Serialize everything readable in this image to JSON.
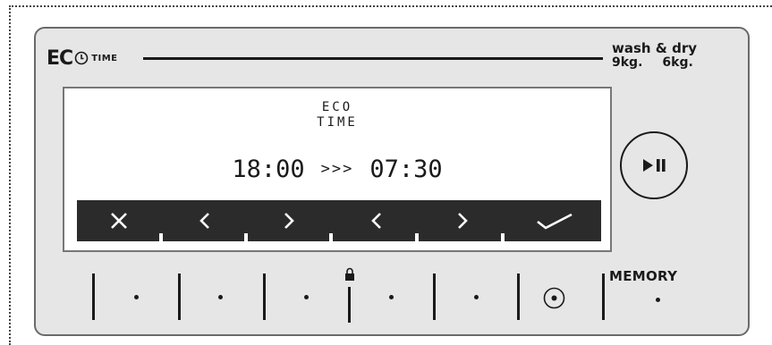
{
  "brand": {
    "logo_text": "EC",
    "time_label": "TIME"
  },
  "spec": {
    "title": "wash & dry",
    "capacity_wash": "9kg.",
    "capacity_dry": "6kg."
  },
  "display": {
    "mode_line1": "ECO",
    "mode_line2": "TIME",
    "start_time": "18:00",
    "arrows": ">>>",
    "end_time": "07:30"
  },
  "softkeys": [
    "close-icon",
    "chevron-left-icon",
    "chevron-right-icon",
    "chevron-left-icon",
    "chevron-right-icon",
    "check-icon"
  ],
  "controls": {
    "play_pause_icon": "play-pause-icon",
    "memory_label": "MEMORY",
    "lock_icon": "lock-icon",
    "target_icon": "target-icon"
  },
  "colors": {
    "panel": "#e6e6e6",
    "softkey_bar": "#2b2b2b",
    "ink": "#1a1a1a"
  }
}
